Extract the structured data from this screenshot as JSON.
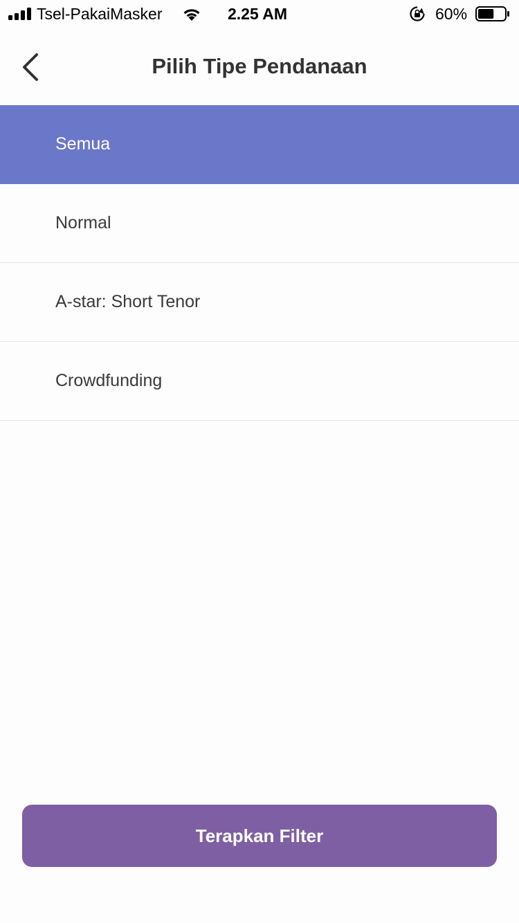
{
  "status_bar": {
    "carrier": "Tsel-PakaiMasker",
    "time": "2.25 AM",
    "battery_percent": "60%",
    "battery_level": 0.6
  },
  "header": {
    "title": "Pilih Tipe Pendanaan",
    "back_icon": "chevron-left-icon"
  },
  "options": [
    {
      "label": "Semua",
      "selected": true
    },
    {
      "label": "Normal",
      "selected": false
    },
    {
      "label": "A-star: Short Tenor",
      "selected": false
    },
    {
      "label": "Crowdfunding",
      "selected": false
    }
  ],
  "apply_button": {
    "label": "Terapkan Filter"
  },
  "colors": {
    "selected_row": "#6b77c9",
    "apply_button": "#7f5fa3"
  }
}
